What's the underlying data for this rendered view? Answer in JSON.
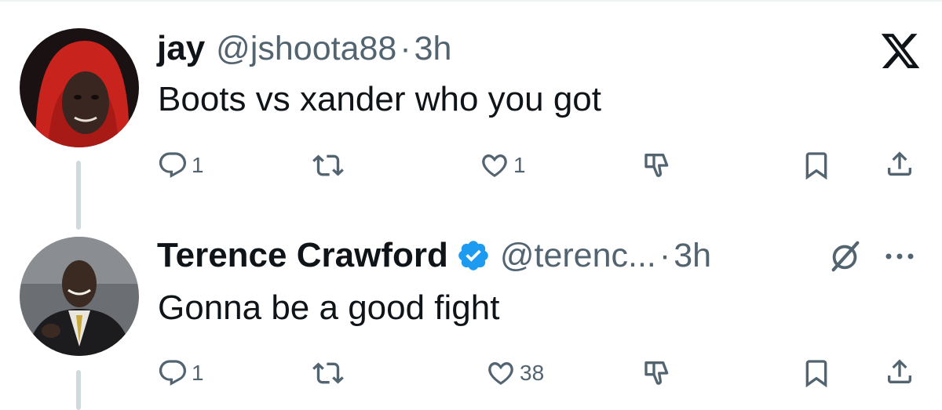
{
  "tweets": [
    {
      "name": "jay",
      "handle": "@jshoota88",
      "separator": "·",
      "time": "3h",
      "text": "Boots vs xander who you got",
      "verified": false,
      "actions": {
        "reply_count": "1",
        "retweet_count": "",
        "like_count": "1"
      }
    },
    {
      "name": "Terence Crawford",
      "handle": "@terenc...",
      "separator": "·",
      "time": "3h",
      "text": "Gonna be a good fight",
      "verified": true,
      "actions": {
        "reply_count": "1",
        "retweet_count": "",
        "like_count": "38"
      }
    }
  ],
  "icons": {
    "brand": "x-logo-icon",
    "reply": "reply-icon",
    "retweet": "retweet-icon",
    "like": "heart-icon",
    "downvote": "thumbs-down-icon",
    "bookmark": "bookmark-icon",
    "share": "share-icon",
    "grok": "grok-icon",
    "more": "more-icon",
    "verified": "verified-badge-icon"
  },
  "colors": {
    "text": "#0f1419",
    "secondary": "#536471",
    "verified": "#1d9bf0",
    "thread_line": "#cfd9de"
  }
}
